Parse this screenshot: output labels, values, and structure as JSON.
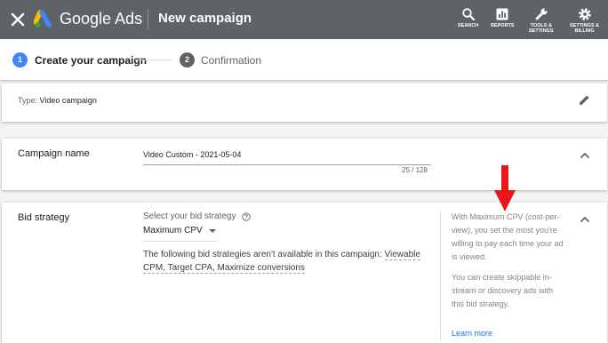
{
  "topbar": {
    "brand": "Google Ads",
    "page_title": "New campaign",
    "tools": [
      {
        "label": "SEARCH",
        "icon": "search-icon"
      },
      {
        "label": "REPORTS",
        "icon": "reports-icon"
      },
      {
        "label": "TOOLS &\nSETTINGS",
        "icon": "wrench-icon"
      },
      {
        "label": "SETTINGS &\nBILLING",
        "icon": "gear-icon"
      }
    ]
  },
  "stepper": {
    "steps": [
      {
        "number": "1",
        "label": "Create your campaign",
        "state": "active"
      },
      {
        "number": "2",
        "label": "Confirmation",
        "state": "inactive"
      }
    ]
  },
  "type_card": {
    "prefix": "Type: ",
    "value": "Video campaign"
  },
  "name_card": {
    "title": "Campaign name",
    "input_value": "Video Custom - 2021-05-04",
    "char_count": "25 / 128"
  },
  "bid_card": {
    "title": "Bid strategy",
    "select_label": "Select your bid strategy",
    "selected": "Maximum CPV",
    "note_prefix": "The following bid strategies aren't available in this campaign: ",
    "note_link": "Viewable CPM, Target CPA, Maximize conversions",
    "side_panel": {
      "paragraph_1": "With Maximum CPV (cost-per-view), you set the most you're willing to pay each time your ad is viewed.",
      "paragraph_2": "You can create skippable in-stream or discovery ads with this bid strategy.",
      "learn_more": "Learn more"
    }
  },
  "colors": {
    "topbar": "#5f6368",
    "accent": "#4285f4",
    "link": "#1a73e8",
    "annotation_arrow": "#e8151b"
  }
}
